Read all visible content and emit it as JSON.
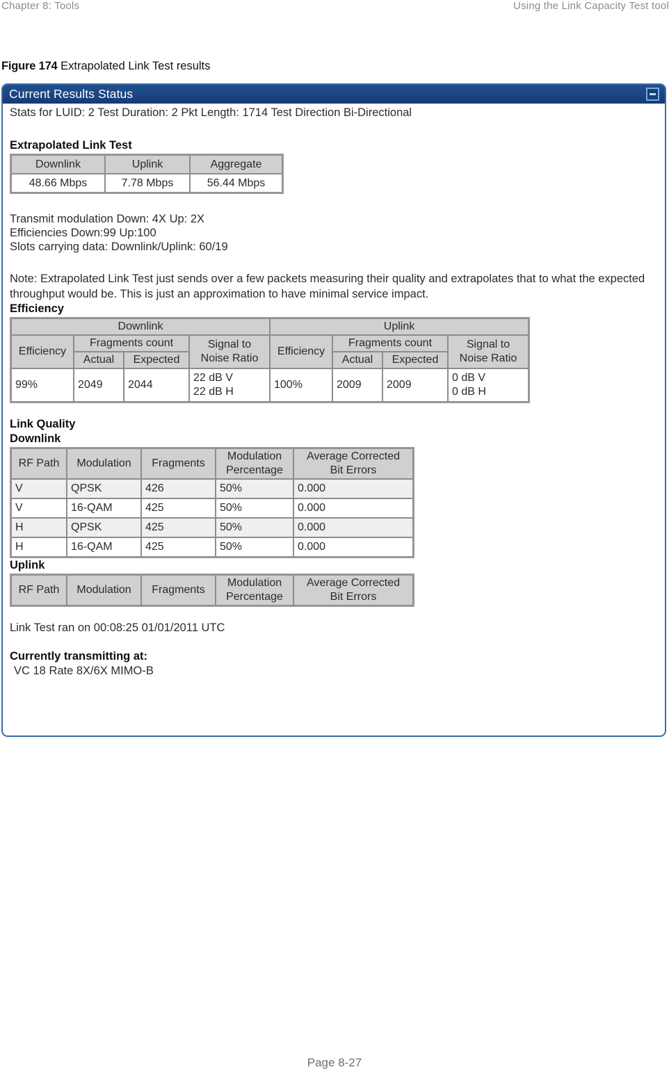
{
  "running_head": {
    "left": "Chapter 8:  Tools",
    "right": "Using the Link Capacity Test tool"
  },
  "figure": {
    "number": "Figure 174",
    "title": "Extrapolated Link Test results"
  },
  "panel": {
    "title": "Current Results Status",
    "minimize_icon": "minimize-icon",
    "stats_line": "Stats for LUID: 2   Test Duration: 2   Pkt Length: 1714   Test Direction Bi-Directional",
    "extrapolated": {
      "heading": "Extrapolated Link Test",
      "headers": [
        "Downlink",
        "Uplink",
        "Aggregate"
      ],
      "values": [
        "48.66 Mbps",
        "7.78 Mbps",
        "56.44 Mbps"
      ]
    },
    "details": [
      "Transmit modulation Down: 4X Up: 2X",
      "Efficiencies Down:99  Up:100",
      "Slots carrying data: Downlink/Uplink: 60/19"
    ],
    "note": "Note: Extrapolated Link Test just sends over a few packets measuring their quality and extrapolates that to what the expected throughput would be. This is just an approximation to have minimal service impact.",
    "efficiency": {
      "heading": "Efficiency",
      "group_headers": [
        "Downlink",
        "Uplink"
      ],
      "sub_headers": {
        "efficiency": "Efficiency",
        "fragments_count": "Fragments count",
        "actual": "Actual",
        "expected": "Expected",
        "snr": "Signal to Noise Ratio"
      },
      "downlink": {
        "efficiency": "99%",
        "actual": "2049",
        "expected": "2044",
        "snr_v": "22 dB V",
        "snr_h": "22 dB H"
      },
      "uplink": {
        "efficiency": "100%",
        "actual": "2009",
        "expected": "2009",
        "snr_v": "0 dB V",
        "snr_h": "0 dB H"
      }
    },
    "link_quality": {
      "heading": "Link Quality",
      "downlink_heading": "Downlink",
      "uplink_heading": "Uplink",
      "columns": [
        "RF Path",
        "Modulation",
        "Fragments",
        "Modulation Percentage",
        "Average Corrected Bit Errors"
      ],
      "columns_split": {
        "rf_path": "RF Path",
        "modulation": "Modulation",
        "fragments": "Fragments",
        "mod_pct_l1": "Modulation",
        "mod_pct_l2": "Percentage",
        "avg_err_l1": "Average Corrected",
        "avg_err_l2": "Bit Errors"
      },
      "downlink_rows": [
        {
          "rf_path": "V",
          "modulation": "QPSK",
          "fragments": "426",
          "mod_pct": "50%",
          "avg_err": "0.000"
        },
        {
          "rf_path": "V",
          "modulation": "16-QAM",
          "fragments": "425",
          "mod_pct": "50%",
          "avg_err": "0.000"
        },
        {
          "rf_path": "H",
          "modulation": "QPSK",
          "fragments": "425",
          "mod_pct": "50%",
          "avg_err": "0.000"
        },
        {
          "rf_path": "H",
          "modulation": "16-QAM",
          "fragments": "425",
          "mod_pct": "50%",
          "avg_err": "0.000"
        }
      ],
      "uplink_rows": []
    },
    "ran_on": "Link Test ran on 00:08:25 01/01/2011 UTC",
    "transmitting": {
      "heading": "Currently transmitting at:",
      "value": "VC 18 Rate 8X/6X MIMO-B"
    }
  },
  "footer": {
    "page": "Page 8-27"
  },
  "colors": {
    "titlebar": "#1b4080",
    "panel_border": "#3a6ea5",
    "table_header": "#d0d0d0",
    "row_alt": "#efefef",
    "running_head": "#8c8c8c"
  }
}
